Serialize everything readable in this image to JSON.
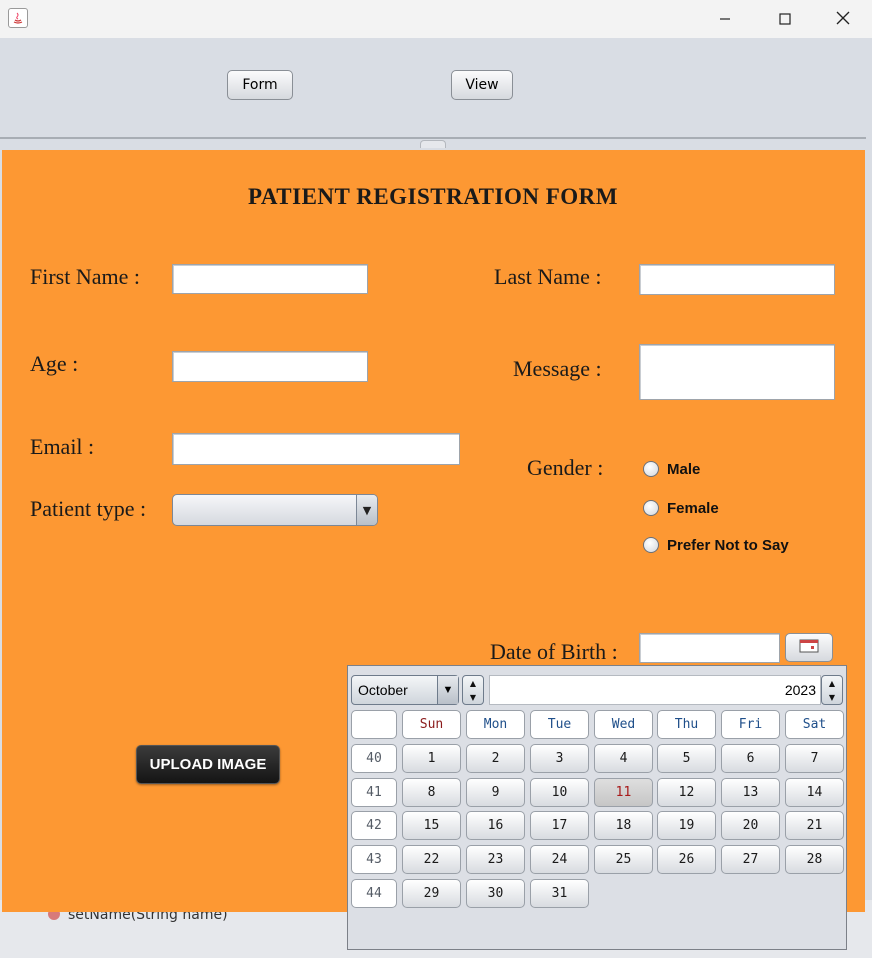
{
  "window": {
    "app_icon": "java-icon",
    "controls": [
      "minimize-icon",
      "maximize-icon",
      "close-icon"
    ]
  },
  "toolbar": {
    "form_label": "Form",
    "view_label": "View"
  },
  "form": {
    "title": "PATIENT REGISTRATION FORM",
    "first_name_label": "First Name :",
    "first_name_value": "",
    "last_name_label": "Last Name :",
    "last_name_value": "",
    "age_label": "Age :",
    "age_value": "",
    "message_label": "Message :",
    "message_value": "",
    "email_label": "Email :",
    "email_value": "",
    "gender_label": "Gender :",
    "gender_options": [
      "Male",
      "Female",
      "Prefer Not to Say"
    ],
    "patient_type_label": "Patient type :",
    "patient_type_value": "",
    "dob_label": "Date of Birth :",
    "dob_value": "",
    "upload_label": "UPLOAD IMAGE",
    "background_color": "#fd9833"
  },
  "calendar": {
    "month": "October",
    "year": "2023",
    "weekdays": [
      "Sun",
      "Mon",
      "Tue",
      "Wed",
      "Thu",
      "Fri",
      "Sat"
    ],
    "week_numbers": [
      "40",
      "41",
      "42",
      "43",
      "44"
    ],
    "weeks": [
      [
        "1",
        "2",
        "3",
        "4",
        "5",
        "6",
        "7"
      ],
      [
        "8",
        "9",
        "10",
        "11",
        "12",
        "13",
        "14"
      ],
      [
        "15",
        "16",
        "17",
        "18",
        "19",
        "20",
        "21"
      ],
      [
        "22",
        "23",
        "24",
        "25",
        "26",
        "27",
        "28"
      ],
      [
        "29",
        "30",
        "31"
      ]
    ],
    "today": "11"
  },
  "background_ide": {
    "line": "setName(String name)"
  }
}
